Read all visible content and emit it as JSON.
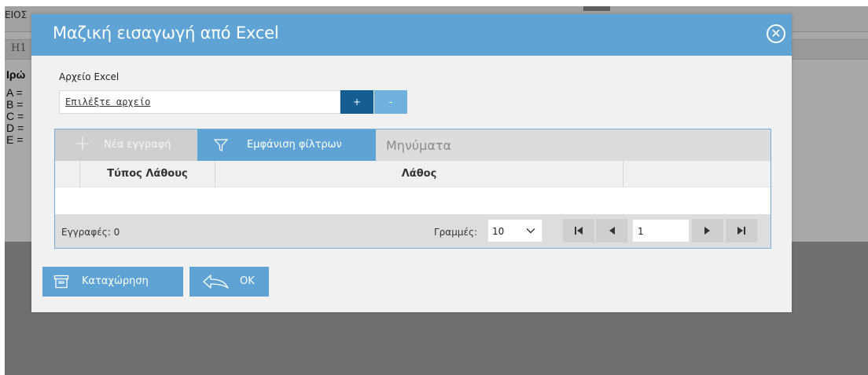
{
  "background": {
    "top_left_text": "ΕΙΟΣ",
    "toolbar_heading": "H1",
    "side_text": {
      "title": "Ιρώ",
      "lines": [
        "A =",
        "B =",
        "C =",
        "D =",
        "E ="
      ]
    }
  },
  "dialog": {
    "title": "Μαζική εισαγωγή από Excel",
    "close_icon": "close-circle-icon",
    "file": {
      "label": "Αρχείο Excel",
      "placeholder": "Επιλέξτε αρχείο",
      "add_label": "+",
      "remove_label": "-"
    },
    "grid": {
      "toolbar": {
        "new_record": "Νέα εγγραφή",
        "show_filters": "Εμφάνιση φίλτρων",
        "messages": "Μηνύματα"
      },
      "columns": [
        "Τύπος Λάθους",
        "Λάθος"
      ],
      "rows": [],
      "footer": {
        "records": "Εγγραφές: 0",
        "rows_label": "Γραμμές:",
        "rows_value": "10",
        "page": "1"
      }
    },
    "buttons": {
      "save": "Καταχώρηση",
      "ok": "OK"
    }
  },
  "colors": {
    "accent": "#5ea3d3",
    "dark_accent": "#155e93",
    "light_accent": "#70b0dc"
  }
}
